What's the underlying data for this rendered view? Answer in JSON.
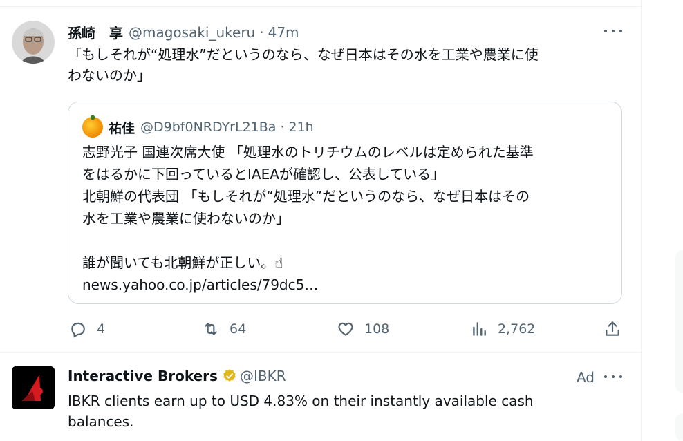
{
  "tweet1": {
    "name": "孫崎　享",
    "handle": "@magosaki_ukeru",
    "separator": "·",
    "time": "47m",
    "text_lines": [
      "「もしそれが“処理水”だというのなら、なぜ日本はその水を工業や農業に使",
      "わないのか」"
    ]
  },
  "quote": {
    "name": "祐佳",
    "handle": "@D9bf0NRDYrL21Ba",
    "separator": "·",
    "time": "21h",
    "lines": [
      "志野光子 国連次席大使 「処理水のトリチウムのレベルは定められた基準",
      "をはるかに下回っているとIAEAが確認し、公表している」",
      "北朝鮮の代表団 「もしそれが“処理水”だというのなら、なぜ日本はその",
      "水を工業や農業に使わないのか」",
      "",
      "誰が聞いても北朝鮮が正しい。☝",
      "news.yahoo.co.jp/articles/79dc5…"
    ]
  },
  "actions": {
    "replies": "4",
    "retweets": "64",
    "likes": "108",
    "views": "2,762"
  },
  "ad_tweet": {
    "name": "Interactive Brokers",
    "handle": "@IBKR",
    "ad_label": "Ad",
    "text_lines": [
      "IBKR clients earn up to USD 4.83% on their instantly available cash",
      "balances."
    ]
  },
  "icons": [
    "more-icon",
    "reply-icon",
    "retweet-icon",
    "like-icon",
    "views-icon",
    "share-icon",
    "verified-icon"
  ],
  "colors": {
    "secondary": "#536471",
    "border": "#cfd9de",
    "verified": "#e2b719"
  }
}
